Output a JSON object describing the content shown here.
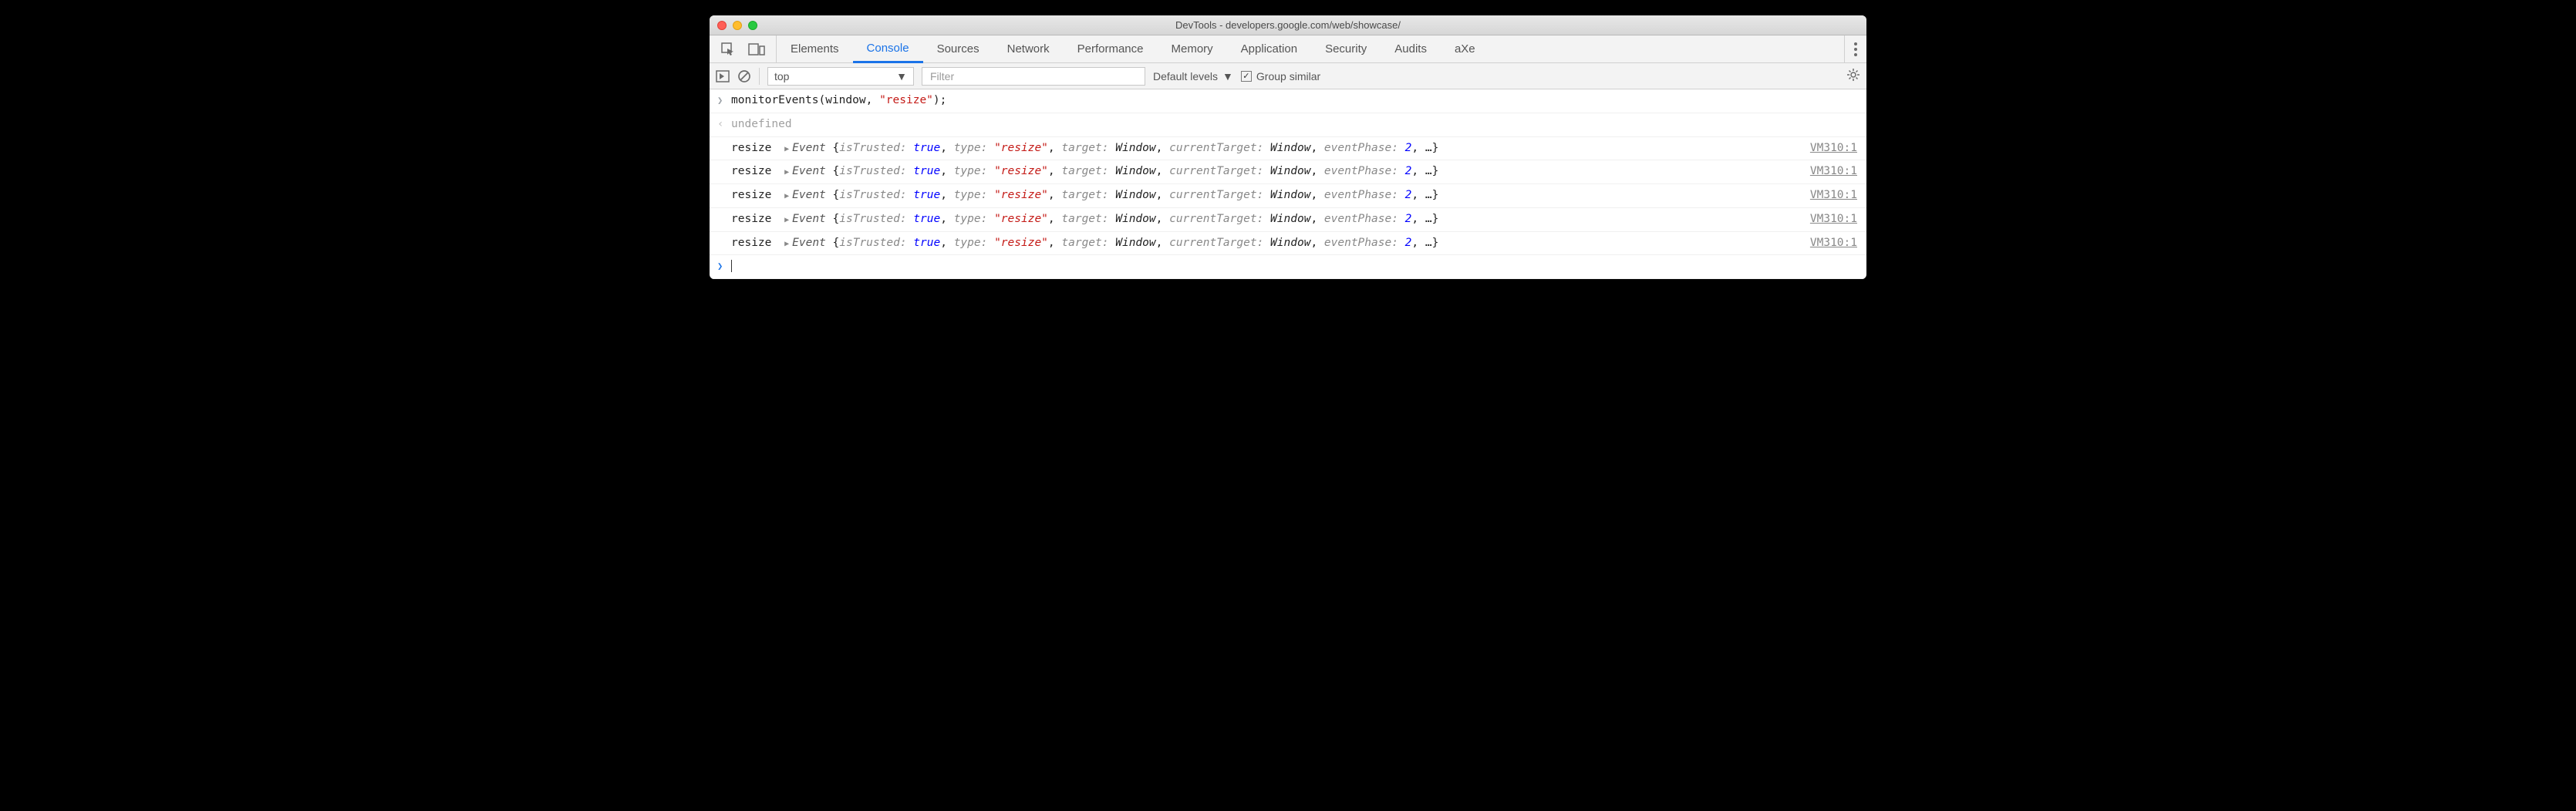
{
  "window": {
    "title": "DevTools - developers.google.com/web/showcase/"
  },
  "tabs": {
    "items": [
      "Elements",
      "Console",
      "Sources",
      "Network",
      "Performance",
      "Memory",
      "Application",
      "Security",
      "Audits",
      "aXe"
    ],
    "active": "Console"
  },
  "toolbar": {
    "context": "top",
    "filter_placeholder": "Filter",
    "filter_value": "",
    "levels": "Default levels",
    "group_similar_label": "Group similar",
    "group_similar_checked": true
  },
  "console": {
    "input": "monitorEvents(window, \"resize\");",
    "input_parts": {
      "call": "monitorEvents(window, ",
      "arg": "\"resize\"",
      "tail": ");"
    },
    "result": "undefined",
    "events": [
      {
        "name": "resize",
        "src": "VM310:1",
        "props": {
          "isTrusted": "true",
          "type": "\"resize\"",
          "target": "Window",
          "currentTarget": "Window",
          "eventPhase": "2"
        }
      },
      {
        "name": "resize",
        "src": "VM310:1",
        "props": {
          "isTrusted": "true",
          "type": "\"resize\"",
          "target": "Window",
          "currentTarget": "Window",
          "eventPhase": "2"
        }
      },
      {
        "name": "resize",
        "src": "VM310:1",
        "props": {
          "isTrusted": "true",
          "type": "\"resize\"",
          "target": "Window",
          "currentTarget": "Window",
          "eventPhase": "2"
        }
      },
      {
        "name": "resize",
        "src": "VM310:1",
        "props": {
          "isTrusted": "true",
          "type": "\"resize\"",
          "target": "Window",
          "currentTarget": "Window",
          "eventPhase": "2"
        }
      },
      {
        "name": "resize",
        "src": "VM310:1",
        "props": {
          "isTrusted": "true",
          "type": "\"resize\"",
          "target": "Window",
          "currentTarget": "Window",
          "eventPhase": "2"
        }
      }
    ]
  }
}
